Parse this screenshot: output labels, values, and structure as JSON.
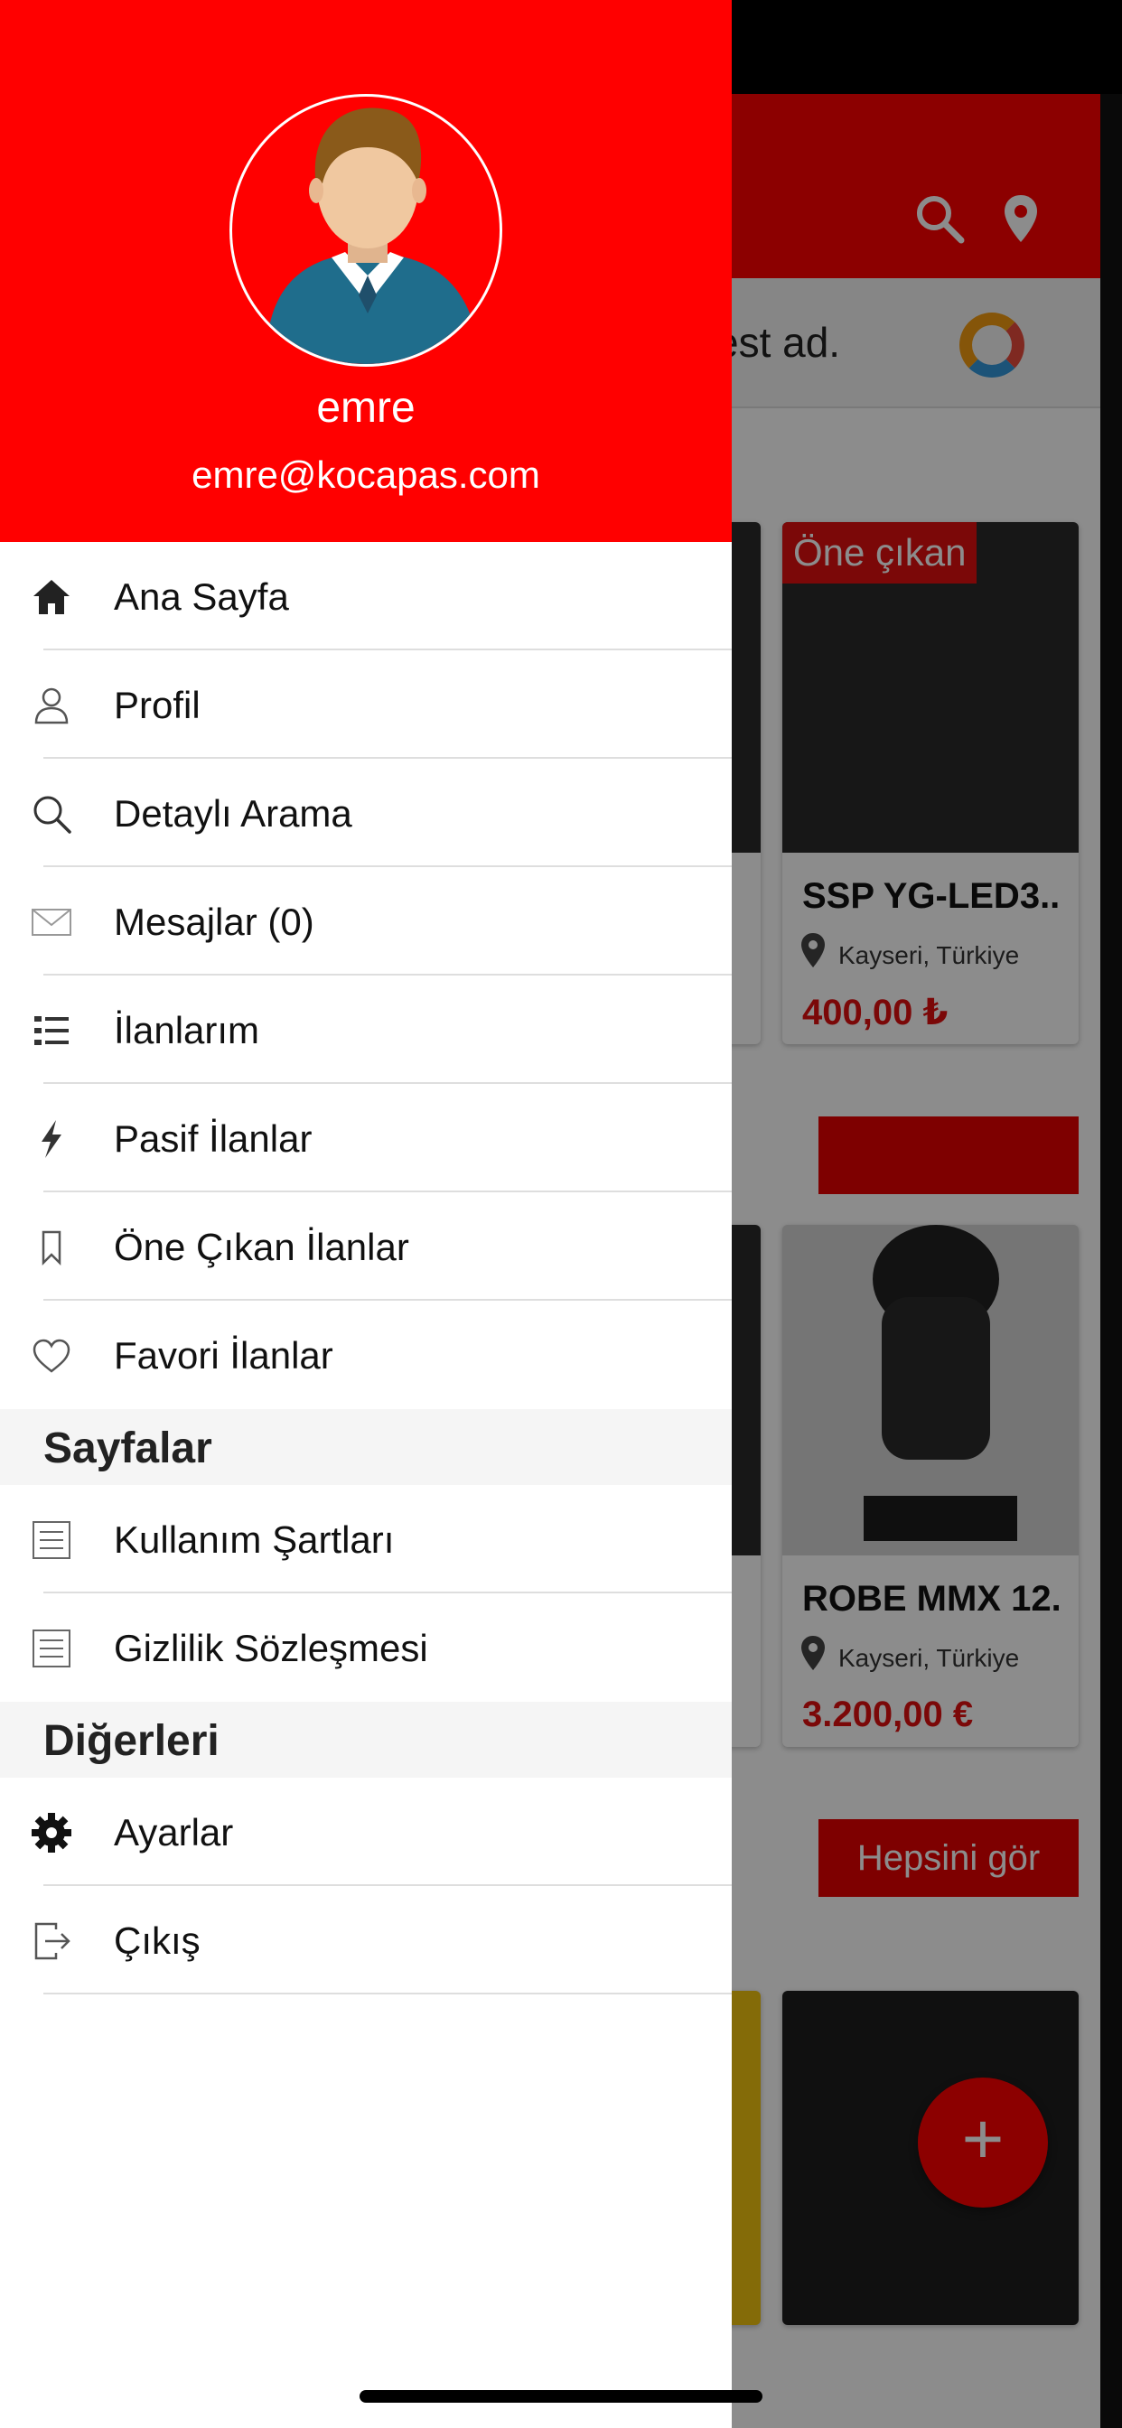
{
  "user": {
    "name": "emre",
    "email": "emre@kocapas.com"
  },
  "menu": [
    {
      "label": "Ana Sayfa",
      "icon": "home-icon"
    },
    {
      "label": "Profil",
      "icon": "user-icon"
    },
    {
      "label": "Detaylı Arama",
      "icon": "search-icon"
    },
    {
      "label": "Mesajlar (0)",
      "icon": "mail-icon"
    },
    {
      "label": "İlanlarım",
      "icon": "list-icon"
    },
    {
      "label": "Pasif İlanlar",
      "icon": "bolt-icon"
    },
    {
      "label": "Öne Çıkan İlanlar",
      "icon": "bookmark-icon"
    },
    {
      "label": "Favori İlanlar",
      "icon": "heart-icon"
    }
  ],
  "sections": {
    "pages": {
      "title": "Sayfalar",
      "items": [
        {
          "label": "Kullanım Şartları",
          "icon": "document-icon"
        },
        {
          "label": "Gizlilik Sözleşmesi",
          "icon": "document-icon"
        }
      ]
    },
    "others": {
      "title": "Diğerleri",
      "items": [
        {
          "label": "Ayarlar",
          "icon": "gear-icon"
        },
        {
          "label": "Çıkış",
          "icon": "logout-icon"
        }
      ]
    }
  },
  "background": {
    "ad_text": "est ad.",
    "cards": [
      {
        "badge": "Öne çıkan",
        "title": "SSP YG-LED3..",
        "location": "Kayseri, Türkiye",
        "price": "400,00 ₺"
      },
      {
        "title": "ROBE MMX 12.",
        "location": "Kayseri, Türkiye",
        "price": "3.200,00 €"
      }
    ],
    "see_all": "Hepsini gör",
    "fab": "+"
  },
  "colors": {
    "primary": "#ff0000",
    "price": "#e01010"
  }
}
